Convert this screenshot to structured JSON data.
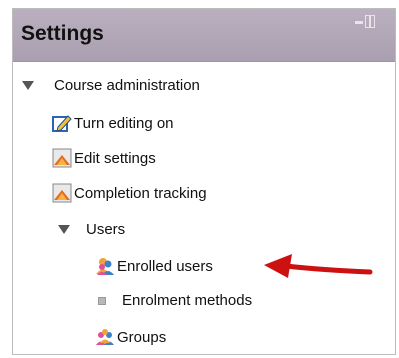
{
  "block": {
    "title": "Settings",
    "dock_icon": "dock-panel-icon",
    "items": [
      {
        "label": "Course administration",
        "icon": "triangle-down-icon"
      },
      {
        "label": "Turn editing on",
        "icon": "edit-pencil-icon"
      },
      {
        "label": "Edit settings",
        "icon": "settings-icon"
      },
      {
        "label": "Completion tracking",
        "icon": "settings-icon"
      },
      {
        "label": "Users",
        "icon": "triangle-down-icon"
      },
      {
        "label": "Enrolled users",
        "icon": "users-icon"
      },
      {
        "label": "Enrolment methods",
        "icon": "bullet-square-icon"
      },
      {
        "label": "Groups",
        "icon": "groups-icon"
      }
    ]
  },
  "annotation": {
    "arrow_color": "#cc1111"
  }
}
